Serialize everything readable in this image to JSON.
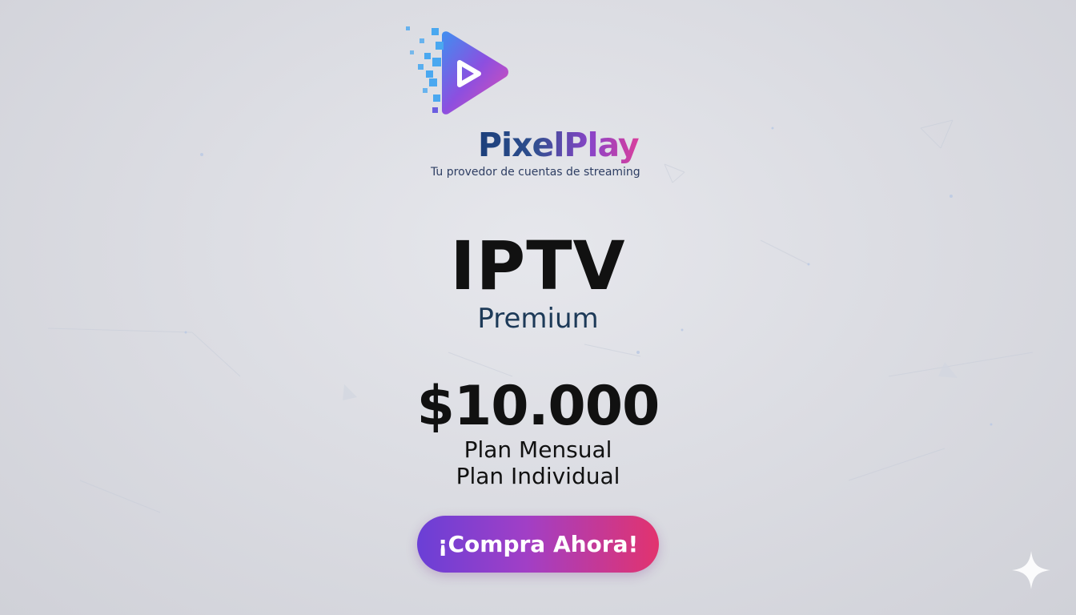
{
  "brand": {
    "name": "PixelPlay",
    "tagline": "Tu provedor de cuentas de streaming",
    "logo_icon": "play-pixel-logo-icon"
  },
  "product": {
    "title": "IPTV",
    "subtitle": "Premium",
    "price": "$10.000",
    "plan_lines": [
      "Plan Mensual",
      "Plan Individual"
    ]
  },
  "cta": {
    "label": "¡Compra Ahora!"
  },
  "colors": {
    "background": "#dcdde3",
    "title": "#111111",
    "subtitle": "#1d3a58",
    "cta_start": "#6a3fd6",
    "cta_end": "#e2336e",
    "logo_blue": "#4aa8f0",
    "logo_pink": "#e24fb0"
  },
  "decor": {
    "sparkle_icon": "sparkle-icon"
  }
}
